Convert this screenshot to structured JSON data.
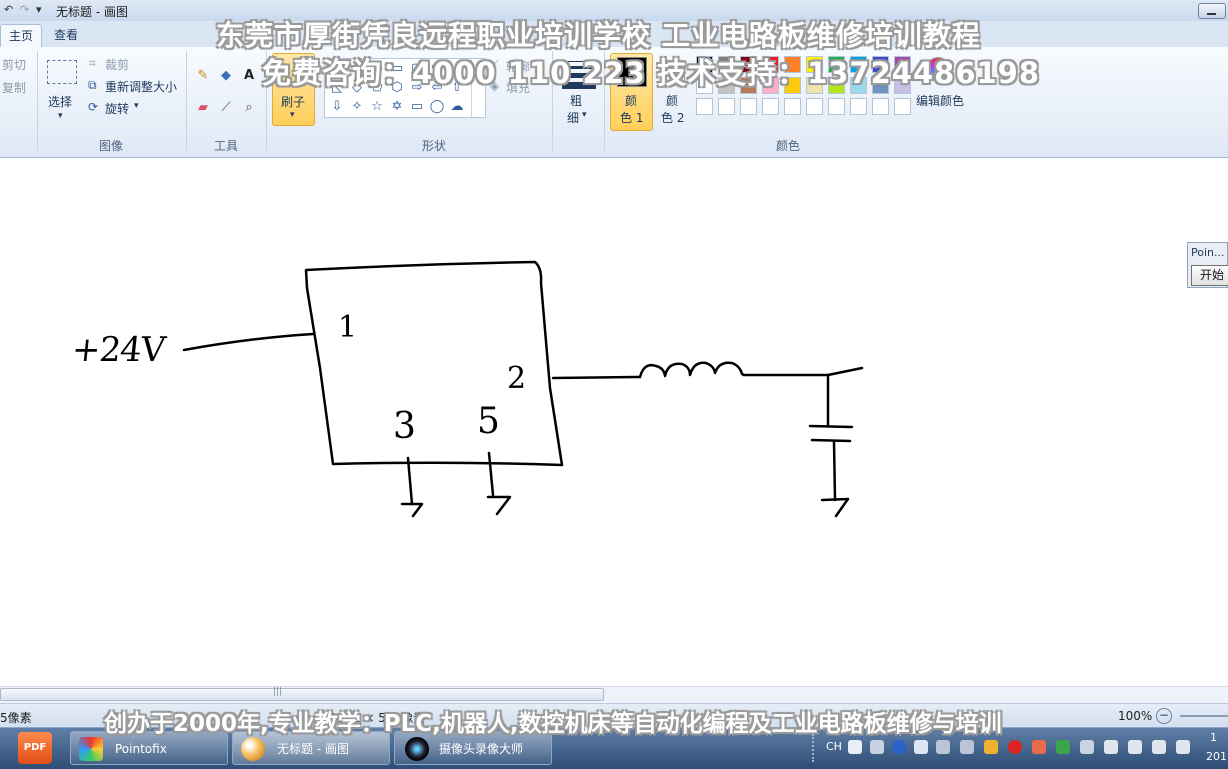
{
  "window": {
    "title": "无标题 - 画图"
  },
  "tabs": [
    {
      "label": "主页"
    },
    {
      "label": "查看"
    }
  ],
  "ribbon": {
    "clipboard": {
      "cut": "剪切",
      "copy": "复制"
    },
    "image": {
      "select": "选择",
      "crop": "裁剪",
      "resize": "重新调整大小",
      "rotate": "旋转",
      "group": "图像"
    },
    "tools": {
      "group": "工具"
    },
    "brush": {
      "label": "刷子"
    },
    "shapes": {
      "outline": "轮廓",
      "fill": "填充",
      "group": "形状"
    },
    "size": {
      "label_top": "粗",
      "label_bottom": "细"
    },
    "color1": {
      "top": "颜",
      "bottom": "色 1"
    },
    "color2": {
      "top": "颜",
      "bottom": "色 2"
    },
    "edit_colors": "编辑颜色",
    "colors_group": "颜色",
    "palette_row1": [
      "#000000",
      "#7f7f7f",
      "#880015",
      "#ed1c24",
      "#ff7f27",
      "#fff200",
      "#22b14c",
      "#00a2e8",
      "#3f48cc",
      "#a349a4"
    ],
    "palette_row2": [
      "#ffffff",
      "#c3c3c3",
      "#b97a57",
      "#ffaec9",
      "#ffc90e",
      "#efe4b0",
      "#b5e61d",
      "#99d9ea",
      "#7092be",
      "#c8bfe7"
    ]
  },
  "drawing": {
    "voltage_label": "+24V",
    "pin1": "1",
    "pin2": "2",
    "pin3": "3",
    "pin5": "5"
  },
  "statusbar": {
    "left": "5像素",
    "size": "1172 × 508像素",
    "zoom": "100%"
  },
  "pointofix_panel": {
    "title": "Poin...",
    "start": "开始"
  },
  "taskbar": {
    "items": [
      {
        "label": "Pointofix"
      },
      {
        "label": "无标题 - 画图"
      },
      {
        "label": "摄像头录像大师"
      }
    ],
    "tray": {
      "lang": "CH",
      "clock_top": "1",
      "clock_bottom": "201"
    }
  },
  "watermark": {
    "line1": "东莞市厚街凭良远程职业培训学校    工业电路板维修培训教程",
    "line2": "免费咨询：4000 110 223  技术支持：13724486198",
    "bottom": "创办于2000年,专业教学：PLC,机器人,数控机床等自动化编程及工业电路板维修与培训"
  }
}
